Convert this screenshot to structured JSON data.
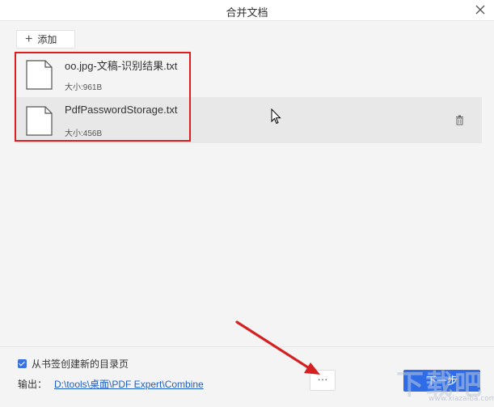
{
  "window": {
    "title": "合并文档"
  },
  "toolbar": {
    "add_label": "添加"
  },
  "files": [
    {
      "name": "oo.jpg-文稿-识别结果.txt",
      "size": "大小:961B"
    },
    {
      "name": "PdfPasswordStorage.txt",
      "size": "大小:456B"
    }
  ],
  "footer": {
    "bookmark_checkbox_label": "从书签创建新的目录页",
    "bookmark_checked": true,
    "output_label": "输出：",
    "output_path": "D:\\tools\\桌面\\PDF Expert\\Combine",
    "more_label": "···",
    "next_label": "下一步"
  },
  "watermark": {
    "big": "下载吧",
    "small": "www.xiazaiba.com"
  },
  "colors": {
    "accent": "#2f6de8",
    "annotation": "#e01c1c",
    "link": "#2060c8"
  },
  "icons": [
    "close-icon",
    "plus-icon",
    "file-icon",
    "trash-icon",
    "checkbox-icon",
    "mouse-cursor-icon",
    "annotation-arrow"
  ]
}
